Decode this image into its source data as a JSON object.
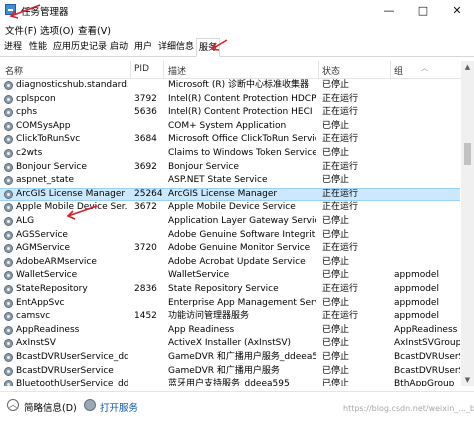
{
  "window": {
    "title": "任务管理器",
    "controls": [
      "—",
      "□",
      "✕"
    ]
  },
  "menu": [
    "文件(F)",
    "选项(O)",
    "查看(V)"
  ],
  "tabs": [
    "进程",
    "性能",
    "应用历史记录",
    "启动",
    "用户",
    "详细信息",
    "服务"
  ],
  "active_tab": "服务",
  "columns": [
    "名称",
    "PID",
    "描述",
    "状态",
    "组"
  ],
  "services": [
    {
      "name": "diagnosticshub.standard...",
      "pid": "",
      "desc": "Microsoft (R) 诊断中心标准收集器",
      "status": "已停止",
      "group": ""
    },
    {
      "name": "cplspcon",
      "pid": "3792",
      "desc": "Intel(R) Content Protection HDCP ...",
      "status": "正在运行",
      "group": ""
    },
    {
      "name": "cphs",
      "pid": "5636",
      "desc": "Intel(R) Content Protection HECI S...",
      "status": "正在运行",
      "group": ""
    },
    {
      "name": "COMSysApp",
      "pid": "",
      "desc": "COM+ System Application",
      "status": "已停止",
      "group": ""
    },
    {
      "name": "ClickToRunSvc",
      "pid": "3684",
      "desc": "Microsoft Office ClickToRun Service",
      "status": "正在运行",
      "group": ""
    },
    {
      "name": "c2wts",
      "pid": "",
      "desc": "Claims to Windows Token Service",
      "status": "已停止",
      "group": ""
    },
    {
      "name": "Bonjour Service",
      "pid": "3692",
      "desc": "Bonjour Service",
      "status": "正在运行",
      "group": ""
    },
    {
      "name": "aspnet_state",
      "pid": "",
      "desc": "ASP.NET State Service",
      "status": "已停止",
      "group": ""
    },
    {
      "name": "ArcGIS License Manager",
      "pid": "25264",
      "desc": "ArcGIS License Manager",
      "status": "正在运行",
      "group": "",
      "selected": true
    },
    {
      "name": "Apple Mobile Device Ser...",
      "pid": "3672",
      "desc": "Apple Mobile Device Service",
      "status": "正在运行",
      "group": ""
    },
    {
      "name": "ALG",
      "pid": "",
      "desc": "Application Layer Gateway Service",
      "status": "已停止",
      "group": ""
    },
    {
      "name": "AGSService",
      "pid": "",
      "desc": "Adobe Genuine Software Integrit...",
      "status": "已停止",
      "group": ""
    },
    {
      "name": "AGMService",
      "pid": "3720",
      "desc": "Adobe Genuine Monitor Service",
      "status": "正在运行",
      "group": ""
    },
    {
      "name": "AdobeARMservice",
      "pid": "",
      "desc": "Adobe Acrobat Update Service",
      "status": "已停止",
      "group": ""
    },
    {
      "name": "WalletService",
      "pid": "",
      "desc": "WalletService",
      "status": "已停止",
      "group": "appmodel"
    },
    {
      "name": "StateRepository",
      "pid": "2836",
      "desc": "State Repository Service",
      "status": "正在运行",
      "group": "appmodel"
    },
    {
      "name": "EntAppSvc",
      "pid": "",
      "desc": "Enterprise App Management Serv...",
      "status": "已停止",
      "group": "appmodel"
    },
    {
      "name": "camsvc",
      "pid": "1452",
      "desc": "功能访问管理器服务",
      "status": "正在运行",
      "group": "appmodel"
    },
    {
      "name": "AppReadiness",
      "pid": "",
      "desc": "App Readiness",
      "status": "已停止",
      "group": "AppReadiness"
    },
    {
      "name": "AxInstSV",
      "pid": "",
      "desc": "ActiveX Installer (AxInstSV)",
      "status": "已停止",
      "group": "AxInstSVGroup"
    },
    {
      "name": "BcastDVRUserService_dd...",
      "pid": "",
      "desc": "GameDVR 和广播用户服务_ddeea5",
      "status": "已停止",
      "group": "BcastDVRUserS..."
    },
    {
      "name": "BcastDVRUserService",
      "pid": "",
      "desc": "GameDVR 和广播用户服务",
      "status": "已停止",
      "group": "BcastDVRUserS..."
    },
    {
      "name": "BluetoothUserService_dd...",
      "pid": "",
      "desc": "蓝牙用户支持服务_ddeea595",
      "status": "已停止",
      "group": "BthAppGroup"
    }
  ],
  "statusbar": {
    "brief_label": "简略信息(D)",
    "open_services_label": "打开服务"
  },
  "watermark": "https://blog.csdn.net/weixin_..._bea..."
}
